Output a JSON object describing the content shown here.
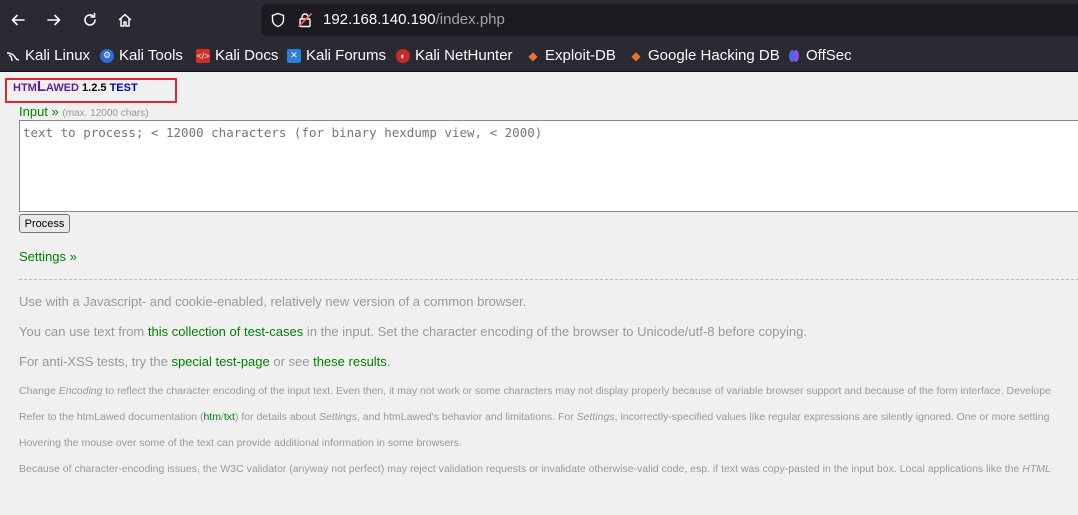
{
  "browser": {
    "url_host": "192.168.140.190",
    "url_path": "/index.php",
    "bookmarks": [
      {
        "label": "Kali Linux",
        "icon": "kali-dragon-icon"
      },
      {
        "label": "Kali Tools",
        "icon": "kali-tools-icon"
      },
      {
        "label": "Kali Docs",
        "icon": "kali-docs-icon"
      },
      {
        "label": "Kali Forums",
        "icon": "kali-forums-icon"
      },
      {
        "label": "Kali NetHunter",
        "icon": "kali-nethunter-icon"
      },
      {
        "label": "Exploit-DB",
        "icon": "exploit-db-icon"
      },
      {
        "label": "Google Hacking DB",
        "icon": "ghdb-icon"
      },
      {
        "label": "OffSec",
        "icon": "offsec-icon"
      }
    ]
  },
  "header": {
    "htm": "HTM",
    "L": "L",
    "awed": "AWED",
    "version": " 1.2.5 ",
    "test": "TEST"
  },
  "input": {
    "label": "Input »",
    "hint": "(max. 12000 chars)",
    "placeholder": "text to process; < 12000 characters (for binary hexdump view, < 2000)"
  },
  "process_label": "Process",
  "settings_label": "Settings »",
  "notes": {
    "p1": "Use with a Javascript- and cookie-enabled, relatively new version of a common browser.",
    "p2_a": "You can use text from ",
    "p2_link": "this collection of test-cases",
    "p2_b": " in the input. Set the character encoding of the browser to Unicode/utf-8 before copying.",
    "p3_a": "For anti-XSS tests, try the ",
    "p3_link1": "special test-page",
    "p3_b": " or see ",
    "p3_link2": "these results",
    "p3_c": ".",
    "s1_a": "Change ",
    "s1_em": "Encoding",
    "s1_b": " to reflect the character encoding of the input text. Even then, it may not work or some characters may not display properly because of variable browser support and because of the form interface. Develope",
    "s2_a": "Refer to the htmLawed documentation (",
    "s2_link1": "htm",
    "s2_slash": "/",
    "s2_link2": "txt",
    "s2_b": ") for details about ",
    "s2_em1": "Settings",
    "s2_c": ", and htmLawed's behavior and limitations. For ",
    "s2_em2": "Settings",
    "s2_d": ", incorrectly-specified values like regular expressions are silently ignored. One or more setting",
    "s3": "Hovering the mouse over some of the text can provide additional information in some browsers.",
    "s4_a": "Because of character-encoding issues, the W3C validator (anyway not perfect) may reject validation requests or invalidate otherwise-valid code, esp. if text was copy-pasted in the input box. Local applications like the ",
    "s4_em": "HTML"
  }
}
